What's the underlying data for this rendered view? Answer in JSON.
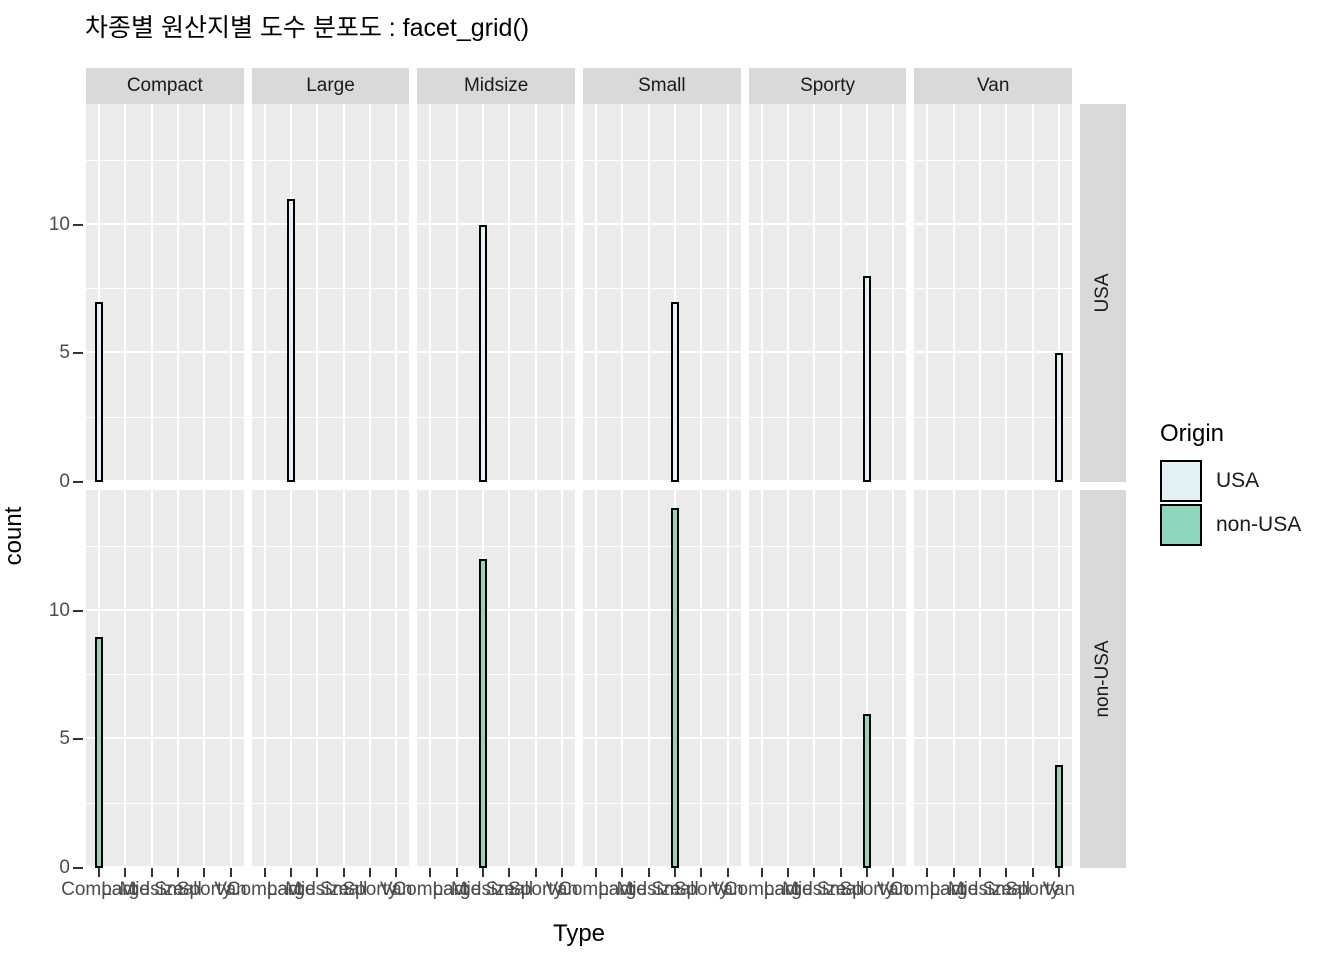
{
  "title": "차종별 원산지별 도수 분포도 : facet_grid()",
  "axes": {
    "x_title": "Type",
    "y_title": "count",
    "y_ticks": [
      0,
      5,
      10
    ],
    "x_tick_labels": [
      "Compact",
      "Large",
      "Midsize",
      "Small",
      "Sporty",
      "Van"
    ]
  },
  "legend": {
    "title": "Origin",
    "items": [
      {
        "label": "USA",
        "color": "#E3F2F7"
      },
      {
        "label": "non-USA",
        "color": "#8FD6BD"
      }
    ]
  },
  "facets": {
    "columns": [
      "Compact",
      "Large",
      "Midsize",
      "Small",
      "Sporty",
      "Van"
    ],
    "rows": [
      "USA",
      "non-USA"
    ]
  },
  "colors": {
    "panel_background": "#EBEBEB",
    "strip_background": "#D9D9D9",
    "gridline": "#FFFFFF",
    "bar_outline": "#000000",
    "usa_fill": "#E3F2F7",
    "non_usa_fill": "#8FD6BD",
    "axis_text": "#4D4D4D",
    "plot_background": "#FFFFFF"
  },
  "chart_data": {
    "type": "bar",
    "title": "차종별 원산지별 도수 분포도 : facet_grid()",
    "xlabel": "Type",
    "ylabel": "count",
    "categories": [
      "Compact",
      "Large",
      "Midsize",
      "Small",
      "Sporty",
      "Van"
    ],
    "ylim": [
      0,
      14.7
    ],
    "yticks": [
      0,
      5,
      10
    ],
    "grid": true,
    "legend_position": "right",
    "legend_title": "Origin",
    "facet_rows": [
      "USA",
      "non-USA"
    ],
    "facet_cols": [
      "Compact",
      "Large",
      "Midsize",
      "Small",
      "Sporty",
      "Van"
    ],
    "series": [
      {
        "name": "USA",
        "color": "#E3F2F7",
        "values": [
          7,
          11,
          10,
          7,
          8,
          5
        ]
      },
      {
        "name": "non-USA",
        "color": "#8FD6BD",
        "values": [
          9,
          0,
          12,
          14,
          6,
          4
        ]
      }
    ],
    "panels": [
      {
        "row": "USA",
        "col": "Compact",
        "bar_category": "Compact",
        "bar_index": 0,
        "value": 7
      },
      {
        "row": "USA",
        "col": "Large",
        "bar_category": "Large",
        "bar_index": 1,
        "value": 11
      },
      {
        "row": "USA",
        "col": "Midsize",
        "bar_category": "Midsize",
        "bar_index": 2,
        "value": 10
      },
      {
        "row": "USA",
        "col": "Small",
        "bar_category": "Small",
        "bar_index": 3,
        "value": 7
      },
      {
        "row": "USA",
        "col": "Sporty",
        "bar_category": "Sporty",
        "bar_index": 4,
        "value": 8
      },
      {
        "row": "USA",
        "col": "Van",
        "bar_category": "Van",
        "bar_index": 5,
        "value": 5
      },
      {
        "row": "non-USA",
        "col": "Compact",
        "bar_category": "Compact",
        "bar_index": 0,
        "value": 9
      },
      {
        "row": "non-USA",
        "col": "Large",
        "bar_category": "Large",
        "bar_index": 1,
        "value": 0
      },
      {
        "row": "non-USA",
        "col": "Midsize",
        "bar_category": "Midsize",
        "bar_index": 2,
        "value": 12
      },
      {
        "row": "non-USA",
        "col": "Small",
        "bar_category": "Small",
        "bar_index": 3,
        "value": 14
      },
      {
        "row": "non-USA",
        "col": "Sporty",
        "bar_category": "Sporty",
        "bar_index": 4,
        "value": 6
      },
      {
        "row": "non-USA",
        "col": "Van",
        "bar_category": "Van",
        "bar_index": 5,
        "value": 4
      }
    ]
  }
}
